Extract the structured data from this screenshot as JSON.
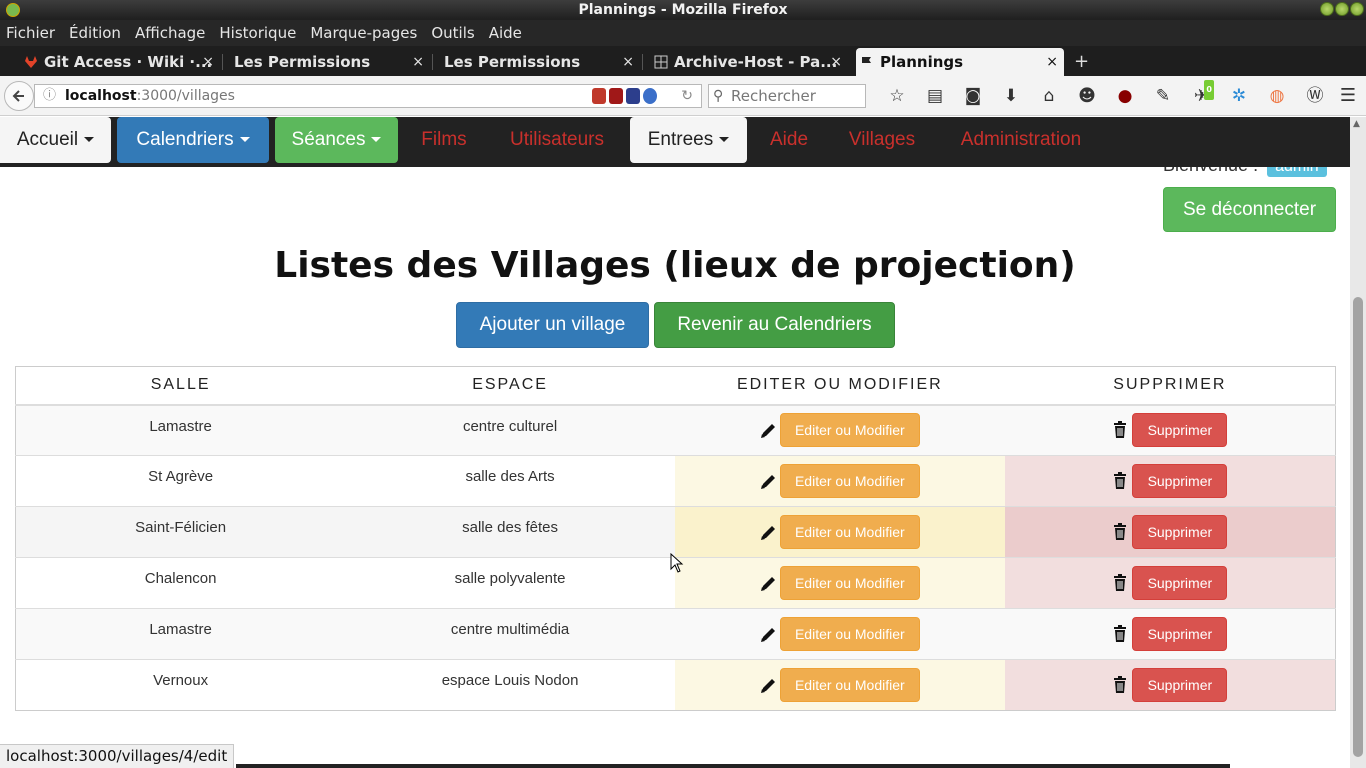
{
  "window": {
    "title": "Plannings - Mozilla Firefox"
  },
  "menu": [
    "Fichier",
    "Édition",
    "Affichage",
    "Historique",
    "Marque-pages",
    "Outils",
    "Aide"
  ],
  "tabs": [
    {
      "label": "Git Access · Wiki ·...",
      "active": false
    },
    {
      "label": "Les Permissions",
      "active": false
    },
    {
      "label": "Les Permissions",
      "active": false
    },
    {
      "label": "Archive-Host - Pa...",
      "active": false
    },
    {
      "label": "Plannings",
      "active": true
    }
  ],
  "tab_close": "×",
  "new_tab": "+",
  "address": {
    "host": "localhost",
    "path": ":3000/villages"
  },
  "search": {
    "placeholder": "Rechercher"
  },
  "addon_badge": "0",
  "app_nav": {
    "accueil": "Accueil",
    "calendriers": "Calendriers",
    "seances": "Séances",
    "films": "Films",
    "utilisateurs": "Utilisateurs",
    "entrees": "Entrees",
    "aide": "Aide",
    "villages": "Villages",
    "administration": "Administration"
  },
  "user": {
    "welcome": "Bienvenue :",
    "name": "admin",
    "logout": "Se déconnecter"
  },
  "page": {
    "title": "Listes des Villages (lieux de projection)",
    "add_button": "Ajouter un village",
    "back_button": "Revenir au Calendriers"
  },
  "table": {
    "headers": [
      "SALLE",
      "ESPACE",
      "EDITER OU MODIFIER",
      "SUPPRIMER"
    ],
    "edit_label": "Editer ou Modifier",
    "delete_label": "Supprimer",
    "rows": [
      {
        "salle": "Lamastre",
        "espace": "centre culturel"
      },
      {
        "salle": "St Agrève",
        "espace": "salle des Arts"
      },
      {
        "salle": "Saint-Félicien",
        "espace": "salle des fêtes"
      },
      {
        "salle": "Chalencon",
        "espace": "salle polyvalente"
      },
      {
        "salle": "Lamastre",
        "espace": "centre multimédia"
      },
      {
        "salle": "Vernoux",
        "espace": "espace Louis Nodon"
      }
    ]
  },
  "status": {
    "url": "localhost:3000/villages/4/edit"
  },
  "colors": {
    "primary": "#337ab7",
    "success": "#5cb85c",
    "warning": "#f0ad4e",
    "danger": "#d9534f",
    "info": "#5bc0de",
    "nav_link": "#c9302c"
  }
}
